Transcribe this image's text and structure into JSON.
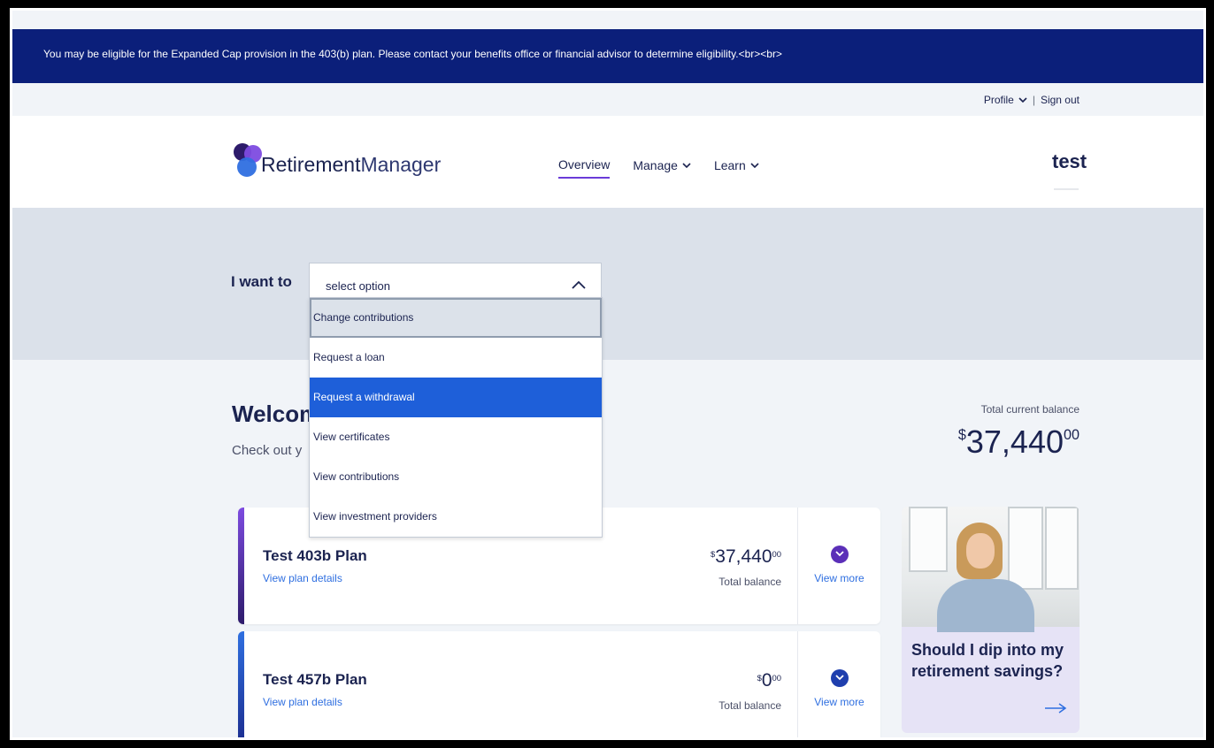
{
  "alert": {
    "text": "You may be eligible for the Expanded Cap provision in the 403(b) plan. Please contact your benefits office or financial advisor to determine eligibility.<br><br>"
  },
  "topbar": {
    "profile": "Profile",
    "signout": "Sign out"
  },
  "header": {
    "brand_bold": "Retirement",
    "brand_light": "Manager",
    "nav": [
      {
        "label": "Overview"
      },
      {
        "label": "Manage"
      },
      {
        "label": "Learn"
      }
    ],
    "client_logo": "test"
  },
  "hero": {
    "label": "I want to",
    "select_placeholder": "select option",
    "options": [
      "Change contributions",
      "Request a loan",
      "Request a withdrawal",
      "View certificates",
      "View contributions",
      "View investment providers"
    ]
  },
  "main": {
    "welcome": "Welcom",
    "subtitle": "Check out y",
    "total_label": "Total current balance",
    "total_dollars": "37,440",
    "total_cents": "00",
    "plans": [
      {
        "name": "Test 403b Plan",
        "link": "View plan details",
        "dollars": "37,440",
        "cents": "00",
        "balance_label": "Total balance",
        "more": "View more",
        "accent": "#6a3bd8"
      },
      {
        "name": "Test 457b Plan",
        "link": "View plan details",
        "dollars": "0",
        "cents": "00",
        "balance_label": "Total balance",
        "more": "View more",
        "accent": "#1f3fae"
      }
    ],
    "promo_text": "Should I dip into my retirement savings?"
  },
  "colors": {
    "navy": "#0b1f7a",
    "accent_purple": "#6a3bd8",
    "link_blue": "#2f6fe0",
    "selected_blue": "#1e5fd9"
  }
}
